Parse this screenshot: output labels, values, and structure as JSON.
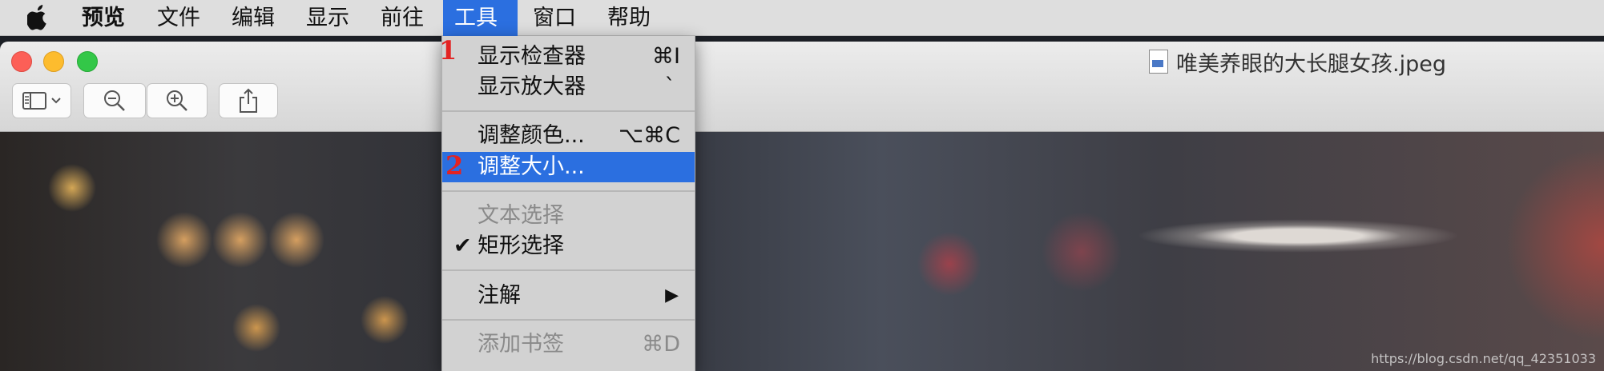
{
  "menubar": {
    "apple_icon": "apple-logo-icon",
    "app_name": "预览",
    "items": [
      "文件",
      "编辑",
      "显示",
      "前往",
      "工具",
      "窗口",
      "帮助"
    ],
    "active_item": "工具"
  },
  "window": {
    "title": "唯美养眼的大长腿女孩.jpeg",
    "file_icon": "jpeg-file-icon",
    "toolbar": {
      "sidebar_icon": "sidebar-icon",
      "zoom_out_icon": "zoom-out-icon",
      "zoom_in_icon": "zoom-in-icon",
      "share_icon": "share-icon"
    }
  },
  "tools_menu": {
    "items": [
      {
        "label": "显示检查器",
        "shortcut": "⌘I",
        "annotation": "1"
      },
      {
        "label": "显示放大器",
        "shortcut": "`"
      },
      {
        "label": "调整颜色...",
        "shortcut": "⌥⌘C"
      },
      {
        "label": "调整大小...",
        "shortcut": "",
        "annotation": "2",
        "highlighted": true
      },
      {
        "label": "文本选择",
        "shortcut": "",
        "disabled": true
      },
      {
        "label": "矩形选择",
        "shortcut": "",
        "checked": true,
        "checkmark": "✔"
      },
      {
        "label": "注解",
        "submenu_arrow": "▶"
      },
      {
        "label": "添加书签",
        "shortcut": "⌘D",
        "disabled": true
      }
    ]
  },
  "watermark": "https://blog.csdn.net/qq_42351033",
  "colors": {
    "menu_highlight": "#2b6fe0",
    "annotation": "#e32322",
    "close": "#fc5f57",
    "minimize": "#fdbc2e",
    "zoom": "#33c748"
  }
}
